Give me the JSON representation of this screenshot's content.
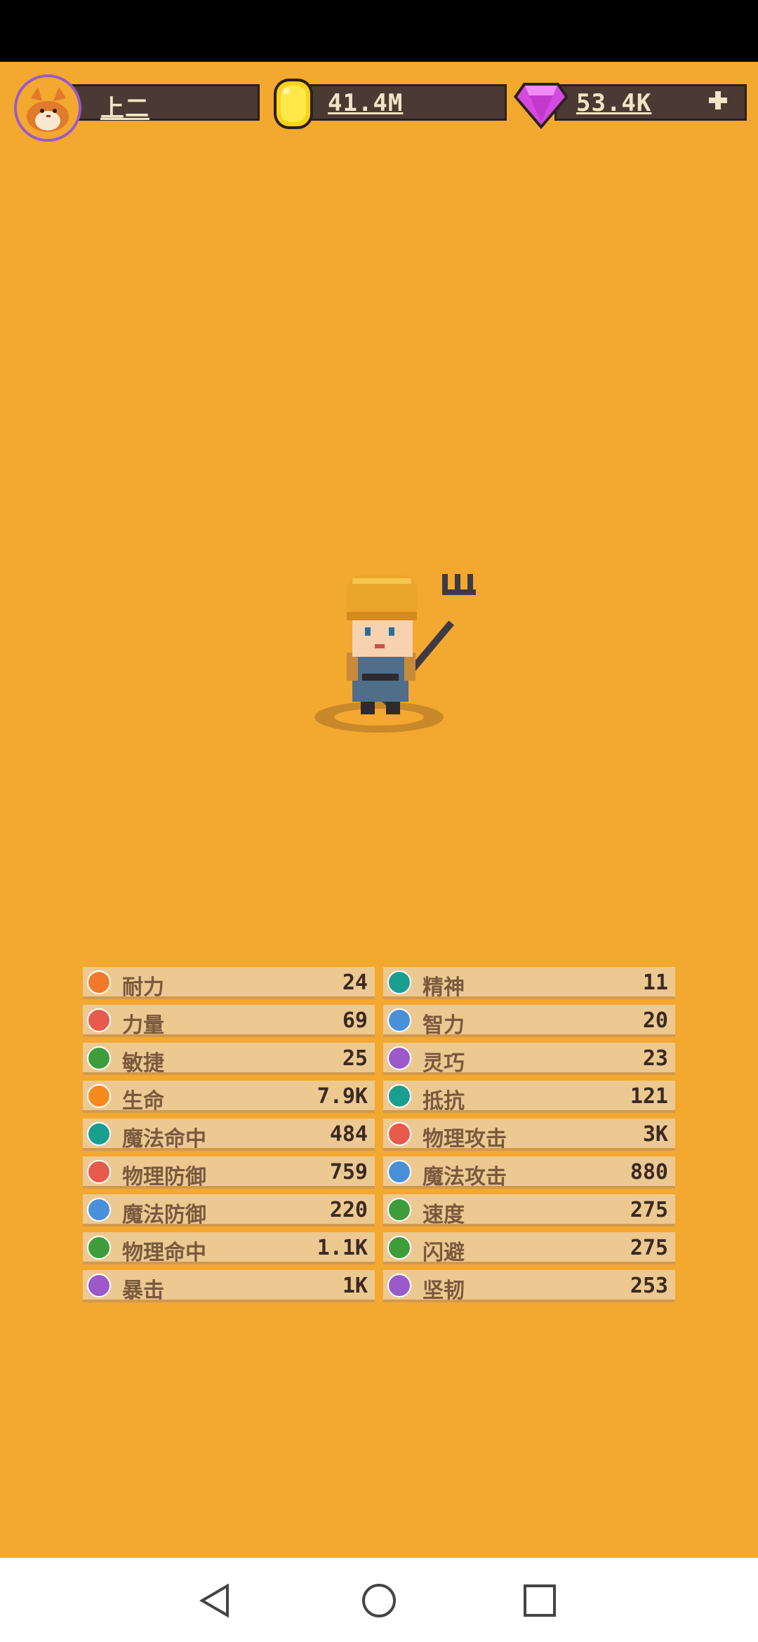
{
  "header": {
    "player_name": "上二",
    "gold": "41.4M",
    "gems": "53.4K"
  },
  "colors": {
    "background": "#F3A82F",
    "pill": "#4A3A33",
    "row": "#EDC992"
  },
  "stats": {
    "left": [
      {
        "label": "耐力",
        "value": "24",
        "icon": "stamina-icon",
        "color": "#F07A2A"
      },
      {
        "label": "力量",
        "value": "69",
        "icon": "strength-icon",
        "color": "#E85A4C"
      },
      {
        "label": "敏捷",
        "value": "25",
        "icon": "agility-icon",
        "color": "#3E9D3A"
      },
      {
        "label": "生命",
        "value": "7.9K",
        "icon": "heart-icon",
        "color": "#F58A1F"
      },
      {
        "label": "魔法命中",
        "value": "484",
        "icon": "magic-hit-icon",
        "color": "#1A9E8F"
      },
      {
        "label": "物理防御",
        "value": "759",
        "icon": "physical-defense-icon",
        "color": "#E85A4C"
      },
      {
        "label": "魔法防御",
        "value": "220",
        "icon": "magic-defense-icon",
        "color": "#4A90D9"
      },
      {
        "label": "物理命中",
        "value": "1.1K",
        "icon": "physical-hit-icon",
        "color": "#3E9D3A"
      },
      {
        "label": "暴击",
        "value": "1K",
        "icon": "crit-icon",
        "color": "#9B59C9"
      }
    ],
    "right": [
      {
        "label": "精神",
        "value": "11",
        "icon": "spirit-icon",
        "color": "#1A9E8F"
      },
      {
        "label": "智力",
        "value": "20",
        "icon": "intellect-icon",
        "color": "#4A90D9"
      },
      {
        "label": "灵巧",
        "value": "23",
        "icon": "dexterity-icon",
        "color": "#9B59C9"
      },
      {
        "label": "抵抗",
        "value": "121",
        "icon": "resistance-icon",
        "color": "#1A9E8F"
      },
      {
        "label": "物理攻击",
        "value": "3K",
        "icon": "physical-attack-icon",
        "color": "#E85A4C"
      },
      {
        "label": "魔法攻击",
        "value": "880",
        "icon": "magic-attack-icon",
        "color": "#4A90D9"
      },
      {
        "label": "速度",
        "value": "275",
        "icon": "speed-icon",
        "color": "#3E9D3A"
      },
      {
        "label": "闪避",
        "value": "275",
        "icon": "dodge-icon",
        "color": "#3E9D3A"
      },
      {
        "label": "坚韧",
        "value": "253",
        "icon": "toughness-icon",
        "color": "#9B59C9"
      }
    ]
  }
}
